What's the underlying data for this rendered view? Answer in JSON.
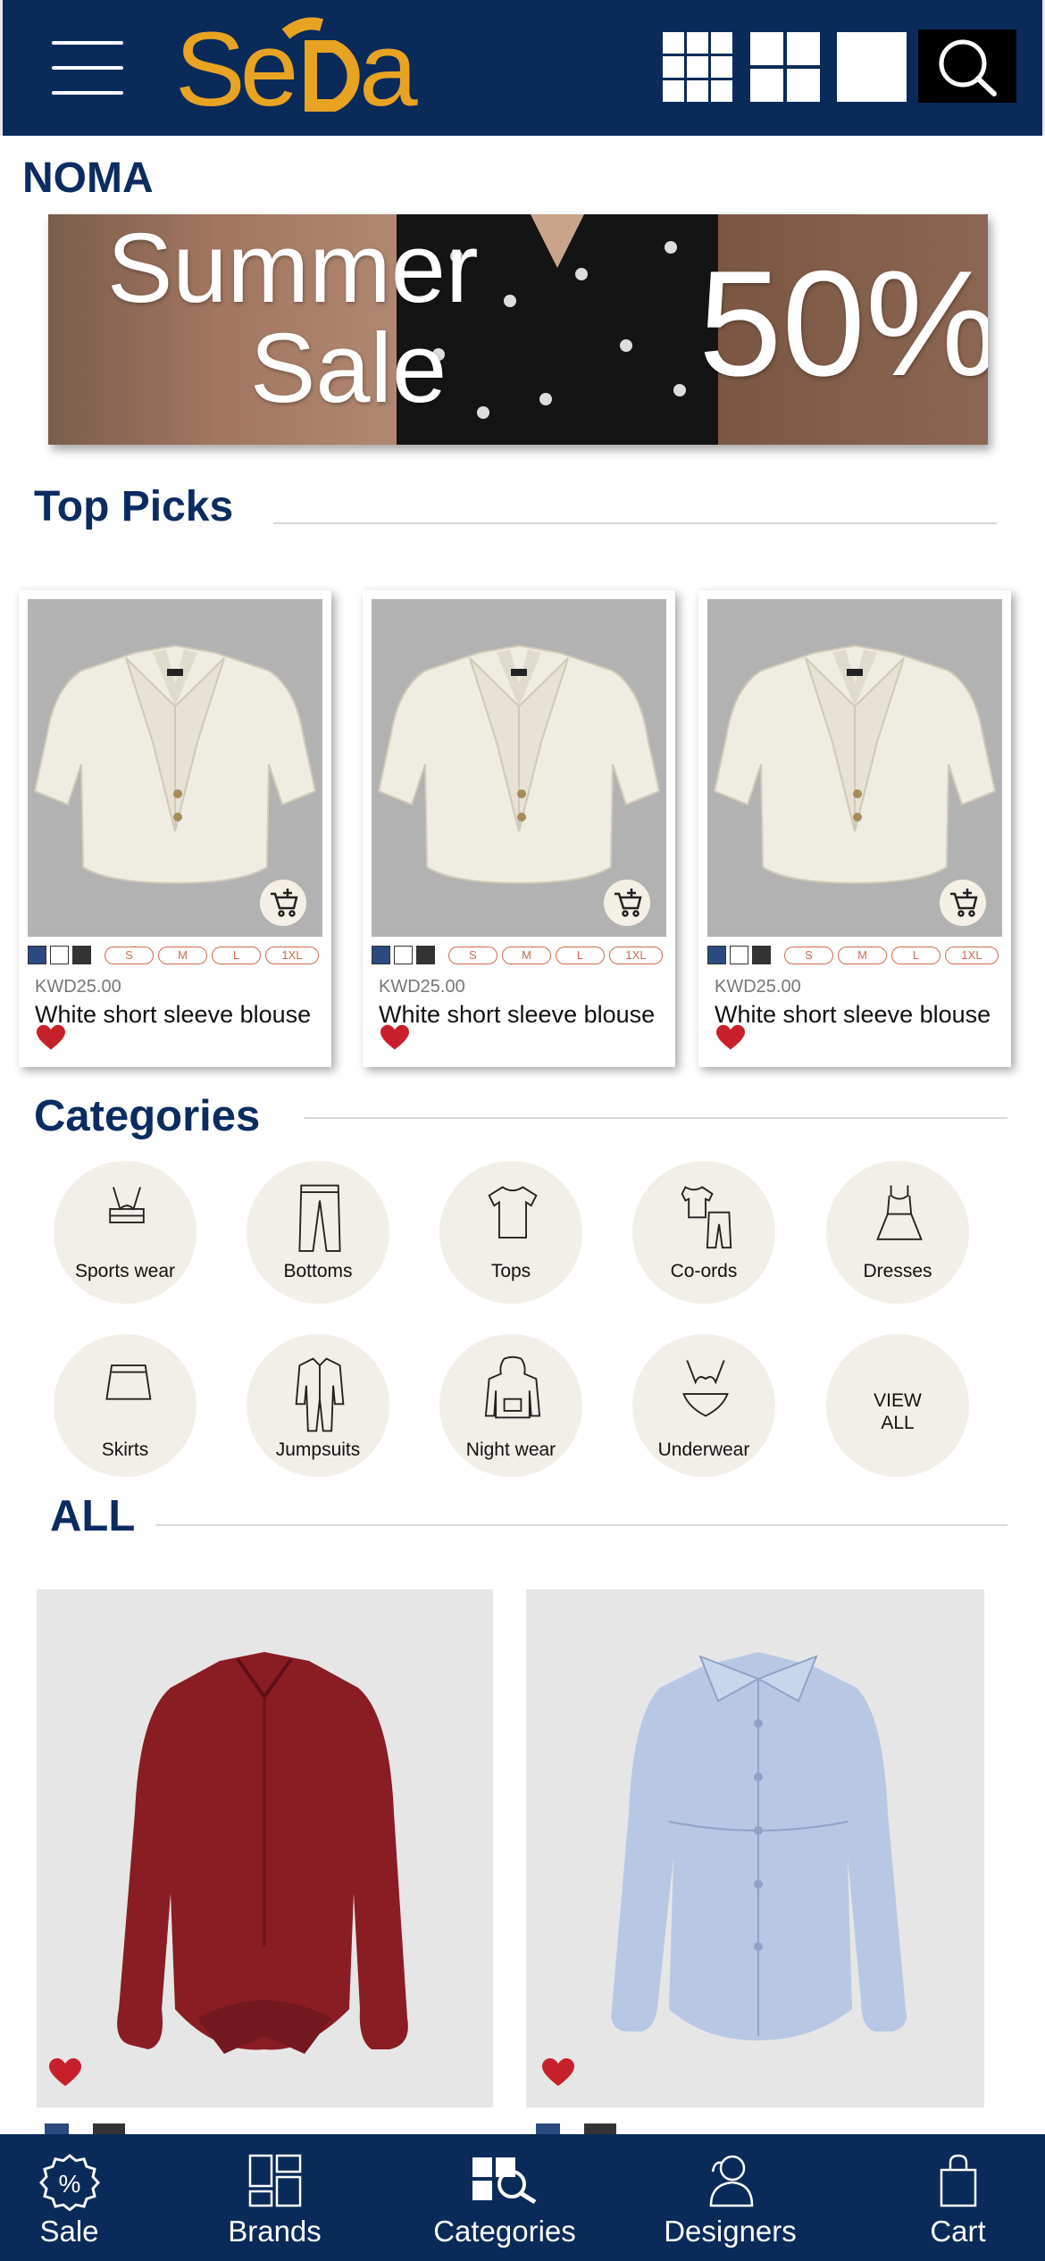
{
  "brand": {
    "logo_text": "SeDa",
    "title": "NOMA"
  },
  "banner": {
    "line1": "Summer",
    "line2": "Sale",
    "discount": "50%"
  },
  "top_picks": {
    "title": "Top Picks",
    "products": [
      {
        "price": "KWD25.00",
        "name": "White short sleeve blouse",
        "sizes": [
          "S",
          "M",
          "L",
          "1XL"
        ]
      },
      {
        "price": "KWD25.00",
        "name": "White short sleeve blouse",
        "sizes": [
          "S",
          "M",
          "L",
          "1XL"
        ]
      },
      {
        "price": "KWD25.00",
        "name": "White short sleeve blouse",
        "sizes": [
          "S",
          "M",
          "L",
          "1XL"
        ]
      }
    ],
    "swatch_colors": [
      "#2b4a80",
      "#ffffff",
      "#333333"
    ]
  },
  "categories": {
    "title": "Categories",
    "items": [
      {
        "label": "Sports wear",
        "icon": "sports-bra-icon"
      },
      {
        "label": "Bottoms",
        "icon": "pants-icon"
      },
      {
        "label": "Tops",
        "icon": "tshirt-icon"
      },
      {
        "label": "Co-ords",
        "icon": "coords-icon"
      },
      {
        "label": "Dresses",
        "icon": "dress-icon"
      },
      {
        "label": "Skirts",
        "icon": "skirt-icon"
      },
      {
        "label": "Jumpsuits",
        "icon": "jumpsuit-icon"
      },
      {
        "label": "Night wear",
        "icon": "hoodie-icon"
      },
      {
        "label": "Underwear",
        "icon": "bikini-icon"
      },
      {
        "label": "VIEW\nALL",
        "icon": ""
      }
    ]
  },
  "all": {
    "title": "ALL",
    "products": [
      {
        "color": "#8a1c24",
        "desc": "burgundy satin blouse"
      },
      {
        "color": "#b8c8e4",
        "desc": "light blue button shirt"
      }
    ]
  },
  "bottom_nav": {
    "items": [
      {
        "label": "Sale",
        "icon": "sale-badge-icon"
      },
      {
        "label": "Brands",
        "icon": "brands-grid-icon"
      },
      {
        "label": "Categories",
        "icon": "categories-search-icon"
      },
      {
        "label": "Designers",
        "icon": "designers-icon"
      },
      {
        "label": "Cart",
        "icon": "shopping-bag-icon"
      }
    ]
  },
  "colors": {
    "navy": "#0a2a5a",
    "gold": "#e8a323",
    "heart": "#c8202a",
    "size_text": "#d06a4a"
  }
}
